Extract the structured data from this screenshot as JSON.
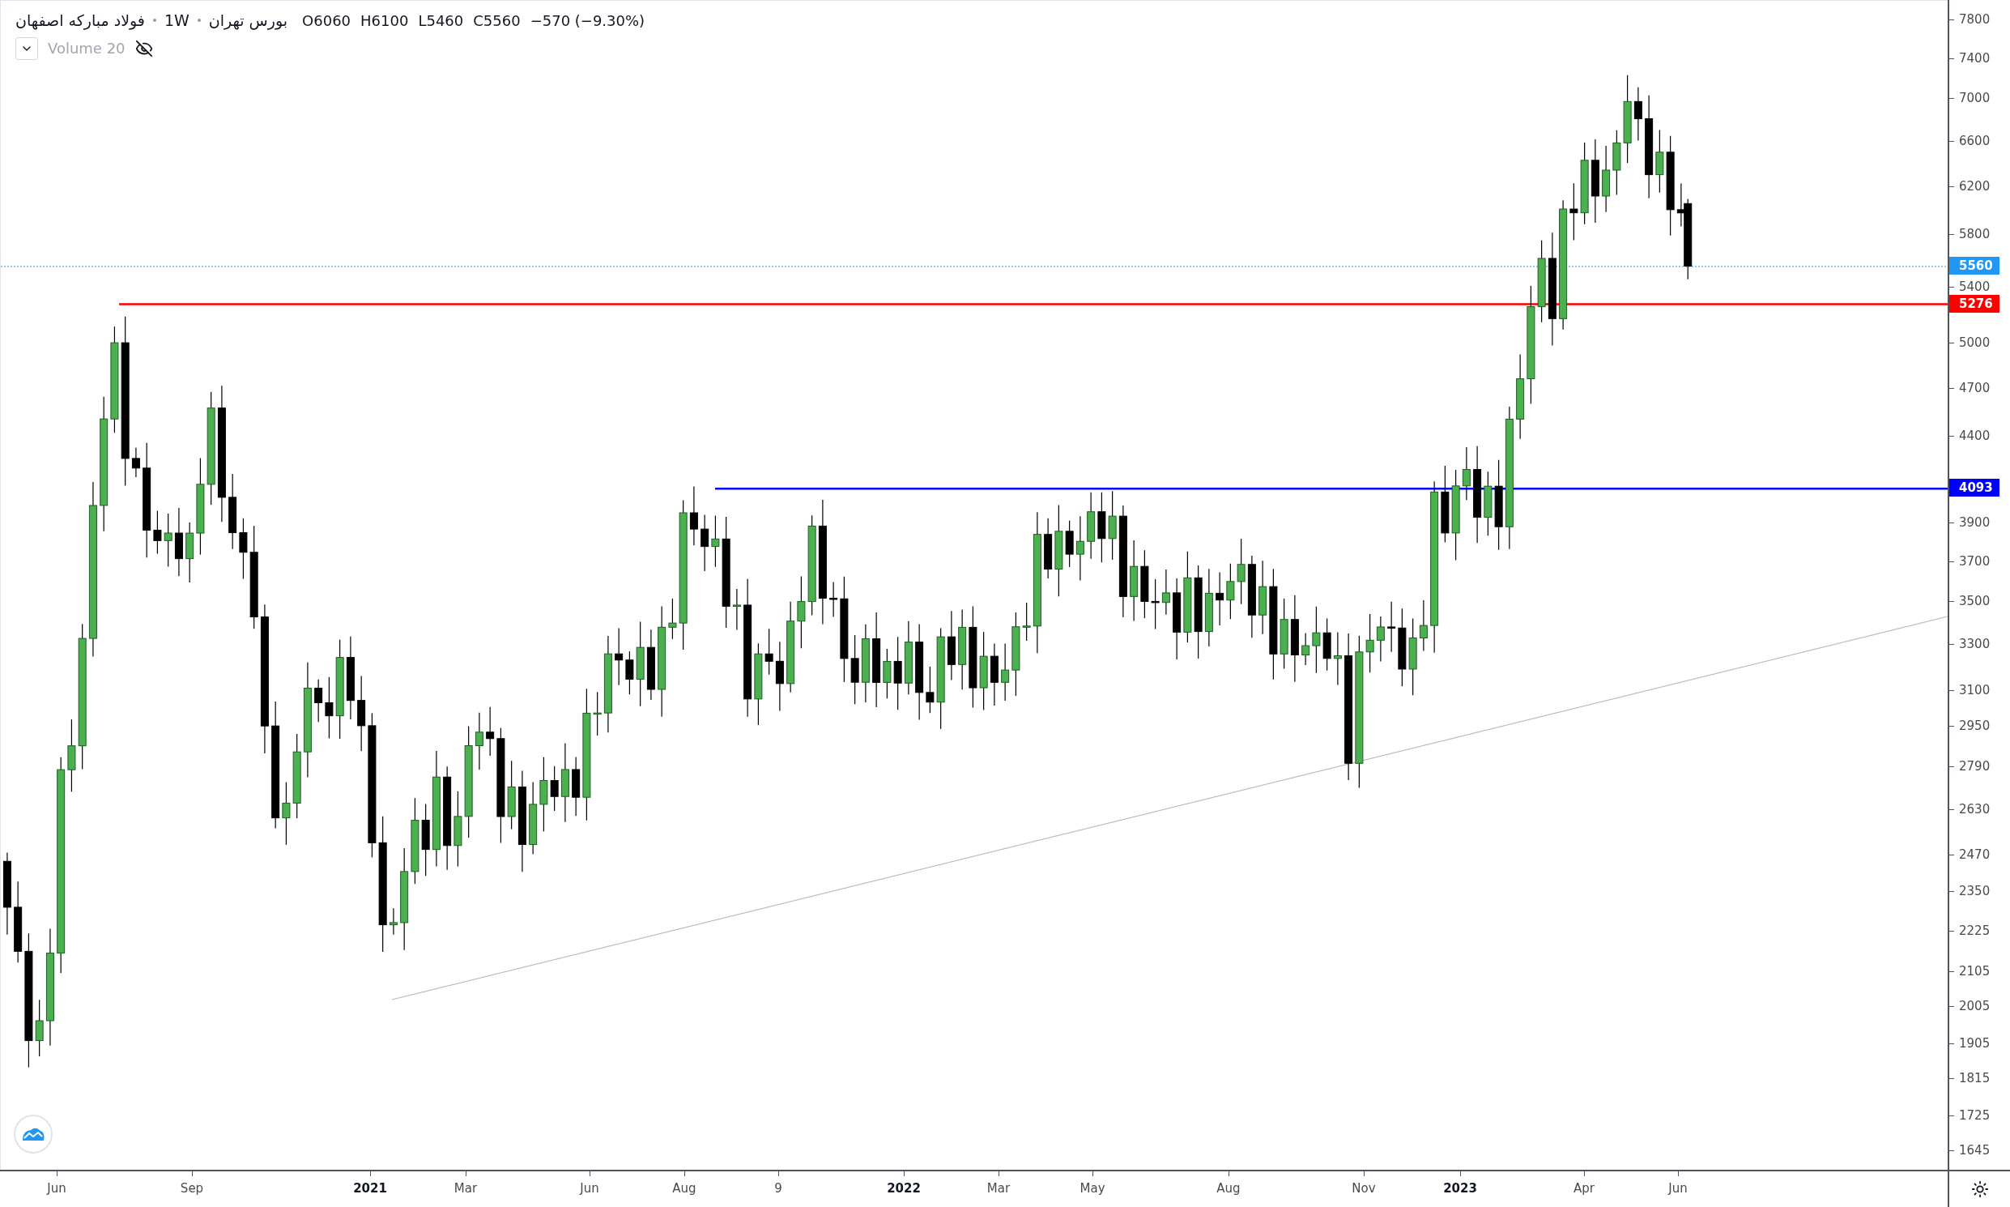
{
  "legend": {
    "symbol": "فولاد مبارکه اصفهان",
    "interval": "1W",
    "exchange": "بورس تهران",
    "ohlc": [
      {
        "label": "O",
        "value": "6060"
      },
      {
        "label": "H",
        "value": "6100"
      },
      {
        "label": "L",
        "value": "5460"
      },
      {
        "label": "C",
        "value": "5560"
      }
    ],
    "change": "−570 (−9.30%)"
  },
  "indicator": {
    "name": "Volume 20",
    "hidden": true
  },
  "price_axis": {
    "labels": [
      "7800",
      "7400",
      "7000",
      "6600",
      "6200",
      "5800",
      "5400",
      "5000",
      "4700",
      "4400",
      "3900",
      "3700",
      "3500",
      "3300",
      "3100",
      "2950",
      "2790",
      "2630",
      "2470",
      "2350",
      "2225",
      "2105",
      "2005",
      "1905",
      "1815",
      "1725",
      "1645"
    ]
  },
  "price_badges": [
    {
      "text": "5560",
      "color": "#2196f3",
      "kind": "last"
    },
    {
      "text": "5276",
      "color": "#ff0000",
      "kind": "level"
    },
    {
      "text": "4093",
      "color": "#0000ff",
      "kind": "level"
    }
  ],
  "time_axis": {
    "labels": [
      {
        "text": "Jun",
        "kind": "month"
      },
      {
        "text": "Sep",
        "kind": "month"
      },
      {
        "text": "2021",
        "kind": "year"
      },
      {
        "text": "Mar",
        "kind": "month"
      },
      {
        "text": "Jun",
        "kind": "month"
      },
      {
        "text": "Aug",
        "kind": "month"
      },
      {
        "text": "9",
        "kind": "month"
      },
      {
        "text": "2022",
        "kind": "year"
      },
      {
        "text": "Mar",
        "kind": "month"
      },
      {
        "text": "May",
        "kind": "month"
      },
      {
        "text": "Aug",
        "kind": "month"
      },
      {
        "text": "Nov",
        "kind": "month"
      },
      {
        "text": "2023",
        "kind": "year"
      },
      {
        "text": "Apr",
        "kind": "month"
      },
      {
        "text": "Jun",
        "kind": "month"
      }
    ]
  }
}
